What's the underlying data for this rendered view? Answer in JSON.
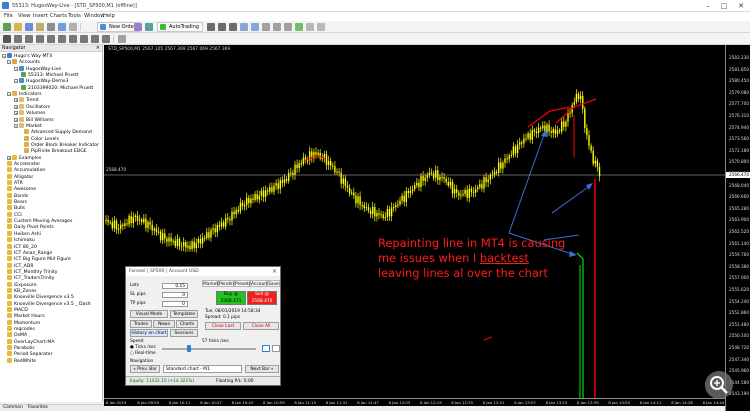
{
  "window": {
    "title": "55313: HugosWay-Live - [STD_SP500,M1 (offline)]",
    "controls": [
      "–",
      "□",
      "✕"
    ]
  },
  "menu": [
    "File",
    "View",
    "Insert",
    "Charts",
    "Tools",
    "Window",
    "Help"
  ],
  "toolbar": {
    "new_order": "New Order",
    "autotrading": "AutoTrading"
  },
  "navigator": {
    "title": "Navigator",
    "root": "Hugo's Way MT4",
    "accounts_label": "Accounts",
    "accounts": [
      {
        "server": "HugosWay-Live",
        "user": "55313: Michael Pruett"
      },
      {
        "server": "HugosWay-Demo3",
        "user": "2103399020: Michael Pruett"
      }
    ],
    "indicators_label": "Indicators",
    "indicator_groups": [
      "Trend",
      "Oscillators",
      "Volumes",
      "Bill Williams",
      "Market"
    ],
    "market_items": [
      "Advanced Supply Demand",
      "Color Levels",
      "Order Block Breaker Indicator",
      "PipFinite Breakout EDGE"
    ],
    "custom": [
      "Examples",
      "Accelerator",
      "Accumulation",
      "Alligator",
      "ATR",
      "Awesome",
      "Bands",
      "Bears",
      "Bulls",
      "CCI",
      "Custom Moving Averages",
      "Daily Pivot Points",
      "Heiken Ashi",
      "Ichimoku",
      "ICT 80_20",
      "ICT Asian_Range",
      "ICT Big Figure Mid Figure",
      "ICT_ADR",
      "ICT_Monthly Trinity",
      "ICT_TradersTrinity",
      "iExposure",
      "KB_Zones",
      "Knoxville Divergence v3.5",
      "Knoxville Divergence v3.5 _ Dash",
      "MACD",
      "Market Hours",
      "Momentum",
      "mqcodes",
      "OsMA",
      "OverLayChart-MA",
      "Parabolic",
      "Period Separator",
      "RedWhite"
    ],
    "bottom_tabs": [
      "Common",
      "Favorites"
    ]
  },
  "chart": {
    "title": "STD_SP500,M1  2567.105 2567.369 2567.069 2567.369",
    "current_price": "2566.470",
    "left_price_label": "2568.470",
    "price_labels": [
      "2583.230",
      "2581.850",
      "2580.450",
      "2579.080",
      "2577.700",
      "2576.310",
      "2574.940",
      "2573.560",
      "2572.180",
      "2570.800",
      "2569.420",
      "2568.040",
      "2566.660",
      "2565.280",
      "2563.900",
      "2562.520",
      "2561.140",
      "2559.760",
      "2558.380",
      "2557.000",
      "2555.620",
      "2554.240",
      "2552.860",
      "2551.480",
      "2550.100",
      "2548.720",
      "2547.340",
      "2545.960",
      "2544.580",
      "2543.190"
    ],
    "time_labels": [
      "8 Jan 2019",
      "8 Jan 09:55",
      "8 Jan 10:11",
      "8 Jan 10:27",
      "8 Jan 10:43",
      "8 Jan 10:59",
      "8 Jan 11:15",
      "8 Jan 11:31",
      "8 Jan 11:47",
      "8 Jan 12:03",
      "8 Jan 12:19",
      "8 Jan 12:35",
      "8 Jan 12:51",
      "8 Jan 13:07",
      "8 Jan 13:23",
      "8 Jan 13:39",
      "8 Jan 13:55",
      "8 Jan 14:11",
      "8 Jan 14:28",
      "8 Jan 14:44"
    ],
    "annotation": {
      "line1": "Repainting line in MT4 is causing",
      "line2_before": "me issues when I ",
      "line2_underlined": "backtest",
      "line3": "leaving lines al over the chart"
    },
    "colors": {
      "candles": "#ffff00",
      "annotation": "#ff1a1a",
      "arrows": "#3b6fd4",
      "repaint_line": "#ff0000",
      "green_line": "#00d000"
    }
  },
  "tester": {
    "title": "Forexel | SP500 | Account USD",
    "lots_label": "Lots",
    "lots_value": "0.15",
    "sl_label": "SL pips",
    "sl_value": "0",
    "tp_label": "TP pips",
    "tp_value": "0",
    "visual_mode": "Visual Mode",
    "templates": "Templates",
    "trades": "Trades",
    "news": "News",
    "charts": "Charts",
    "history_on_chart": "History on chart",
    "sessions": "Sessions",
    "tabs": [
      "Market",
      "Pending",
      "Presets",
      "Account",
      "Save"
    ],
    "buy_label": "Buy @",
    "buy_price": "2568.471",
    "sell_label": "Sell @",
    "sell_price": "2568.470",
    "datetime": "Tue, 08/01/2019   14:58:34",
    "spread": "Spread:  0.1 pips",
    "close_last": "Close Last",
    "close_all": "Close All",
    "speed_label": "Speed",
    "speed_ticks_label": "57 ticks /sec",
    "radio_ticks": "Ticks /sec",
    "radio_realtime": "Real-time",
    "navigation_label": "Navigation",
    "prev_bar": "« Prev. Bar",
    "chart_select": "Standard chart - M1",
    "next_bar": "Next Bar »",
    "equity": "Equity:  11432.10  (+14.321%)",
    "floating": "Floating P/L:  0.00"
  }
}
